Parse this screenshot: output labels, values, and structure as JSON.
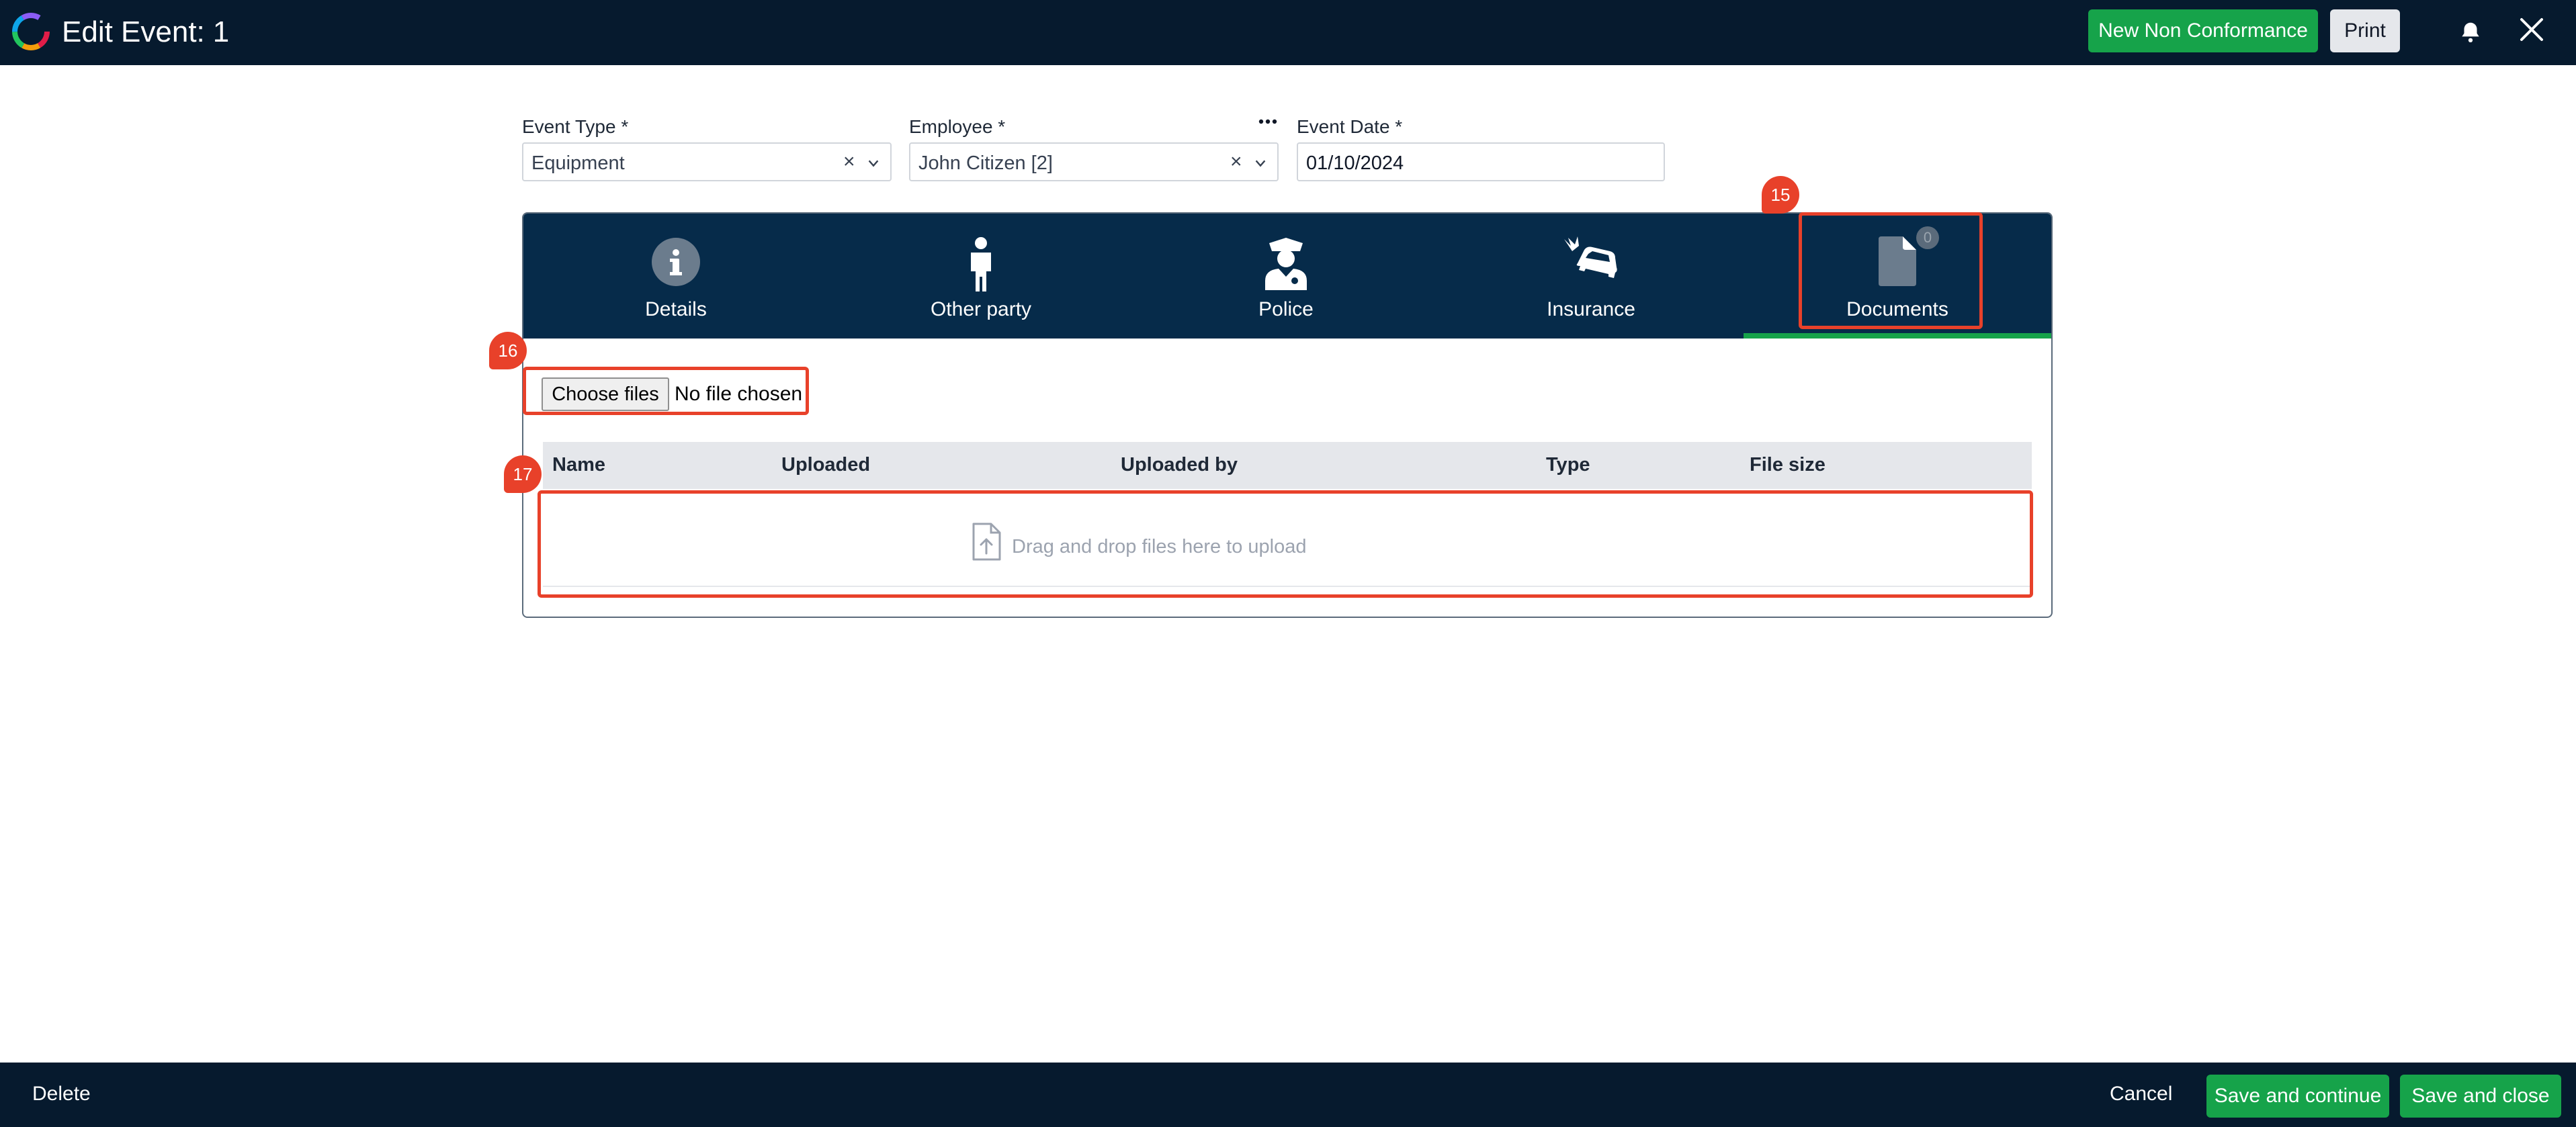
{
  "header": {
    "title": "Edit Event:",
    "event_number": "1",
    "new_nc_label": "New Non Conformance",
    "print_label": "Print",
    "icons": [
      "logo-icon",
      "bell-icon",
      "close-icon"
    ]
  },
  "form": {
    "event_type": {
      "label": "Event Type *",
      "value": "Equipment",
      "clear": "×"
    },
    "employee": {
      "label": "Employee *",
      "value": "John Citizen [2]",
      "clear": "×"
    },
    "event_date": {
      "label": "Event Date *",
      "value": "01/10/2024"
    }
  },
  "tabs": [
    {
      "label": "Details",
      "icon": "info-icon"
    },
    {
      "label": "Other party",
      "icon": "person-icon"
    },
    {
      "label": "Police",
      "icon": "police-officer-icon"
    },
    {
      "label": "Insurance",
      "icon": "car-crash-icon"
    },
    {
      "label": "Documents",
      "icon": "document-icon",
      "badge": "0",
      "active": true
    }
  ],
  "documents": {
    "choose_label": "Choose files",
    "no_file_text": "No file chosen",
    "columns": [
      "Name",
      "Uploaded",
      "Uploaded by",
      "Type",
      "File size"
    ],
    "drop_text": "Drag and drop files here to upload"
  },
  "annotations": [
    "15",
    "16",
    "17"
  ],
  "footer": {
    "delete_label": "Delete",
    "cancel_label": "Cancel",
    "save_continue_label": "Save and continue",
    "save_close_label": "Save and close"
  },
  "colors": {
    "topbar": "#061a2e",
    "tabbar": "#062b4a",
    "accent_green": "#16a34a",
    "annotation_red": "#e8412a"
  }
}
